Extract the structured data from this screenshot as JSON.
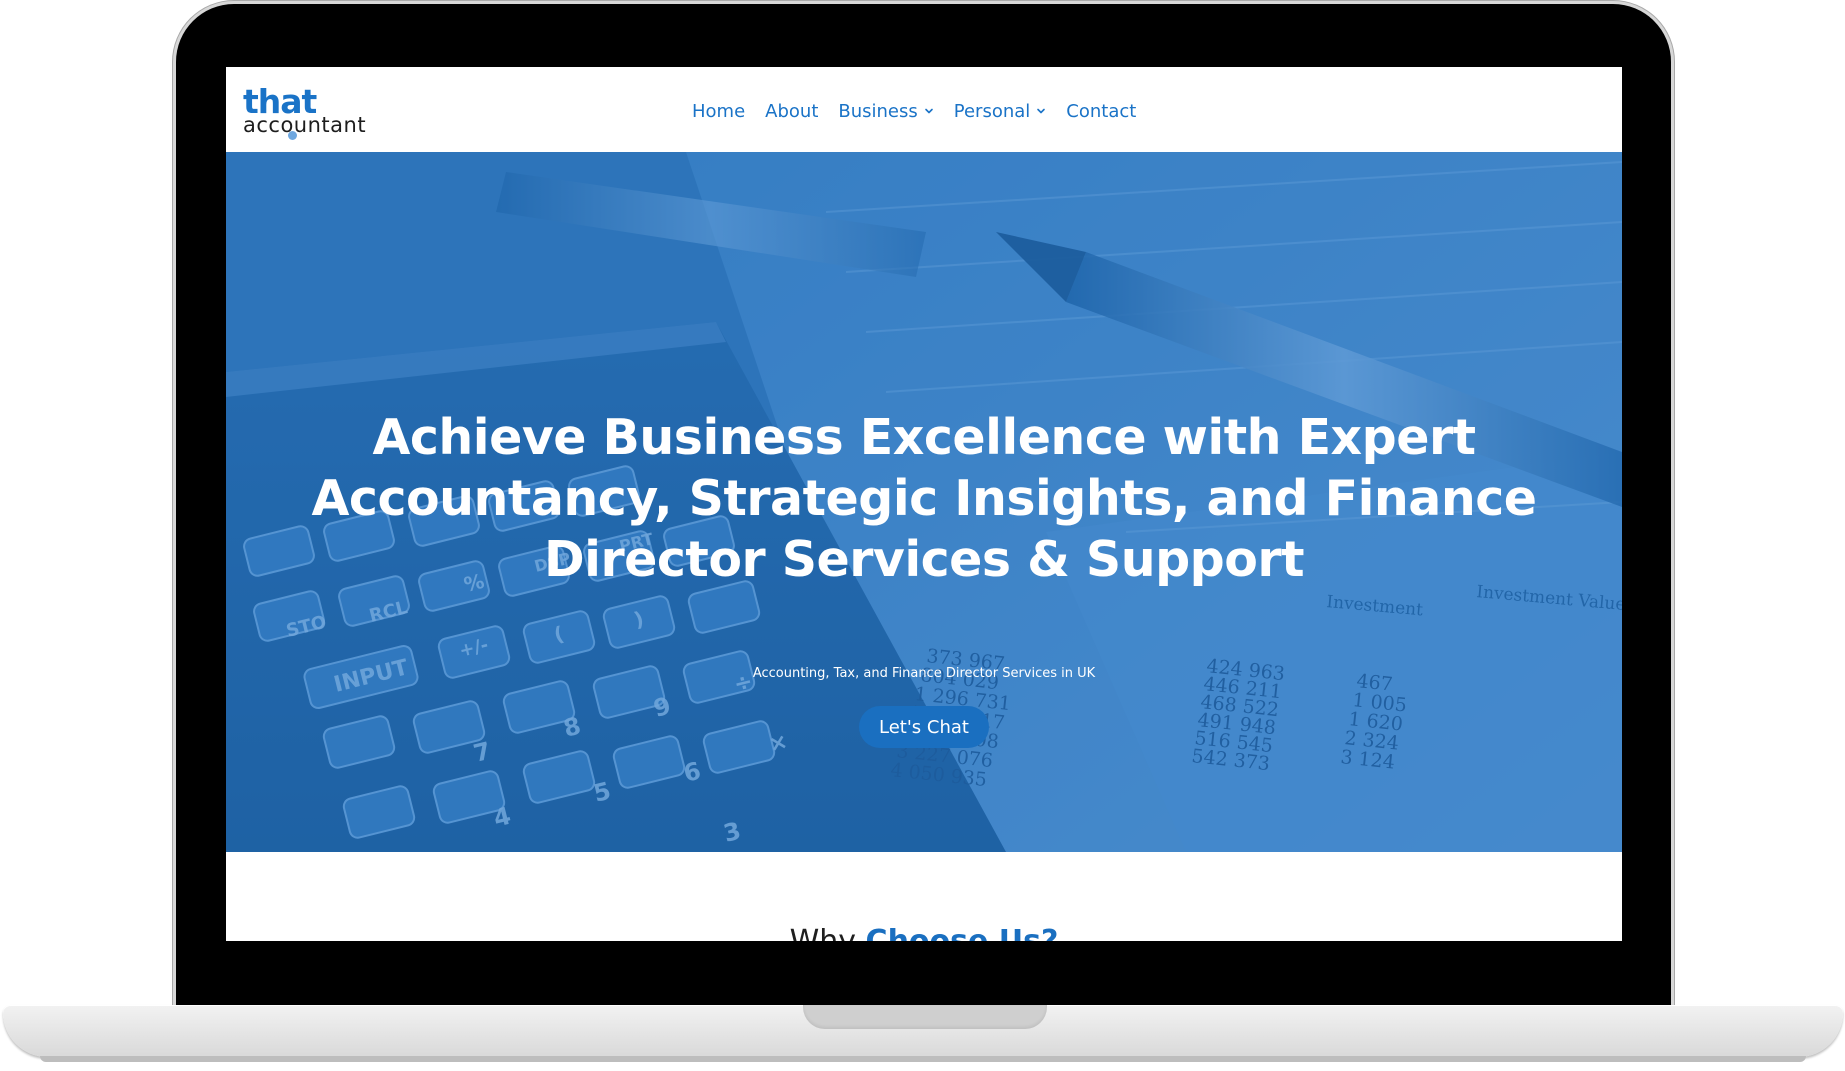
{
  "logo": {
    "line1": "that",
    "line2": "accountant"
  },
  "nav": {
    "items": [
      {
        "label": "Home",
        "dropdown": false
      },
      {
        "label": "About",
        "dropdown": false
      },
      {
        "label": "Business",
        "dropdown": true
      },
      {
        "label": "Personal",
        "dropdown": true
      },
      {
        "label": "Contact",
        "dropdown": false
      }
    ]
  },
  "hero": {
    "title_line1": "Achieve Business Excellence with Expert",
    "title_line2": "Accountancy, Strategic Insights, and Finance",
    "title_line3": "Director Services & Support",
    "subtitle": "Accounting, Tax, and Finance Director Services in UK",
    "cta_label": "Let's Chat"
  },
  "calculator_keys": [
    "STO",
    "RCL",
    "%",
    "DSP",
    "PRT",
    "INPUT",
    "+/-",
    "(",
    ")",
    "7",
    "8",
    "9",
    "÷",
    "4",
    "5",
    "6",
    "×",
    "3"
  ],
  "printout": {
    "column_headers": [
      "Investment",
      "Investment Value at Year"
    ],
    "values_col1": [
      "373 967",
      "804 029",
      "1 296 731",
      "1 859 317",
      "2 499 808",
      "3 227 076",
      "4 050 935"
    ],
    "values_col2": [
      "424 963",
      "446 211",
      "468 522",
      "491 948",
      "516 545",
      "542 373"
    ],
    "values_col3": [
      "467",
      "1 005",
      "1 620",
      "2 324",
      "3 124"
    ]
  },
  "section": {
    "title_part1": "Why ",
    "title_part2": "Choose Us?"
  },
  "colors": {
    "brand_blue": "#1a73c7",
    "hero_overlay": "#2f78bd",
    "cta_bg": "#1a6fc0"
  }
}
